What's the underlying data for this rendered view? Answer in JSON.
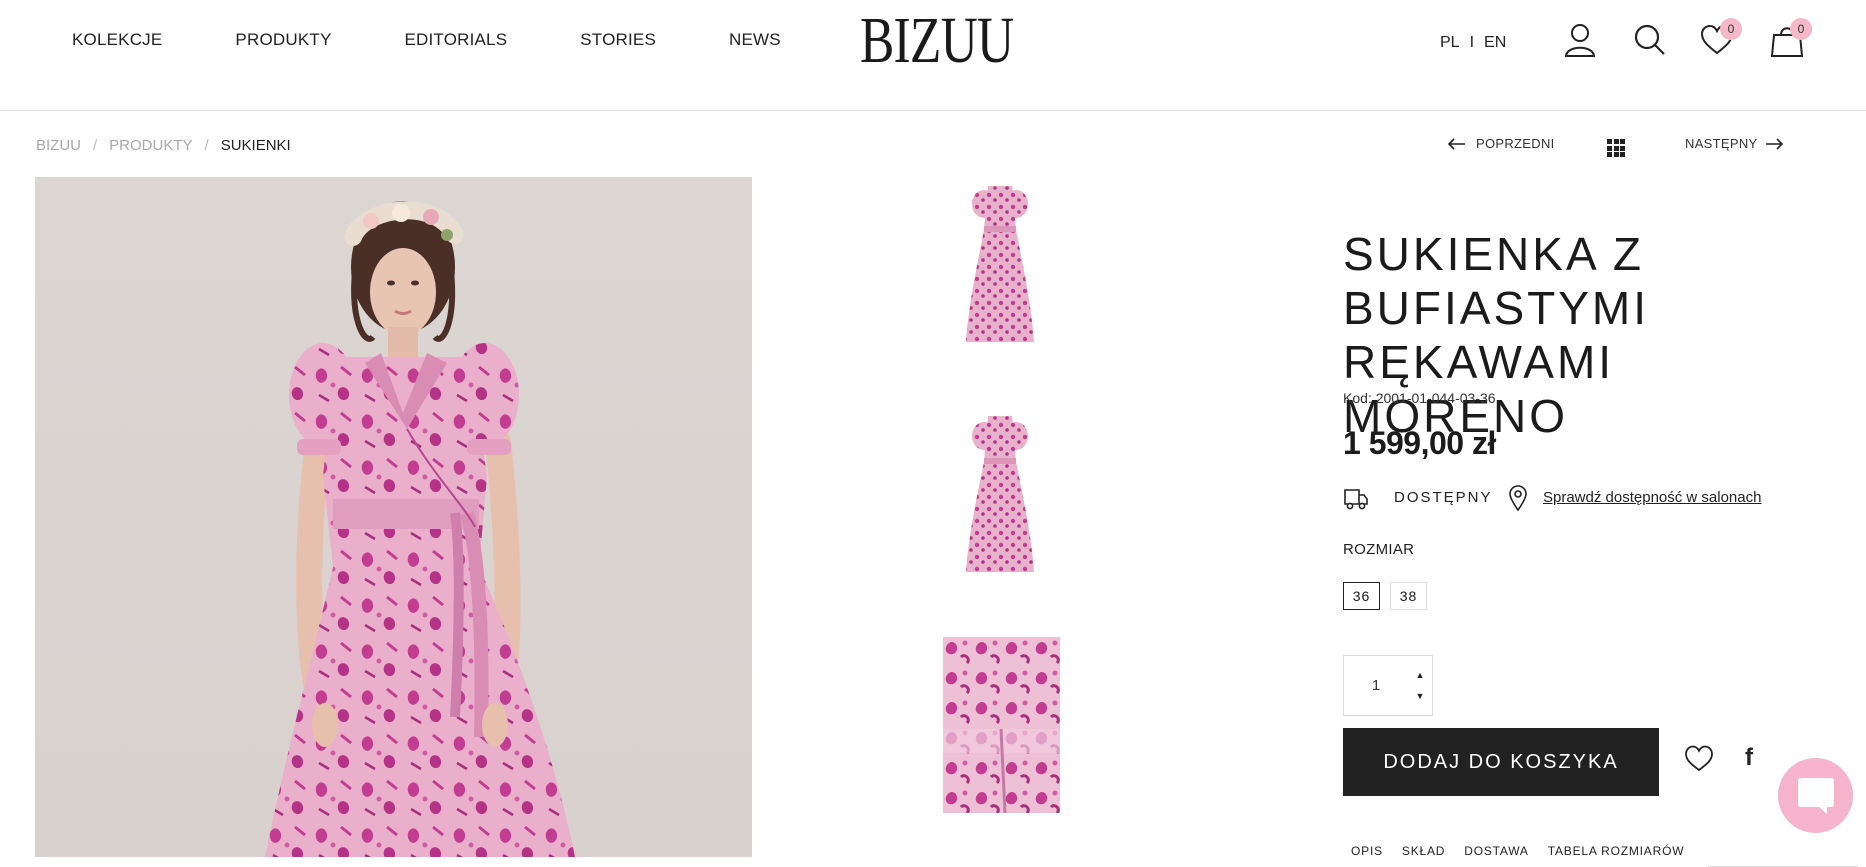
{
  "header": {
    "nav": [
      "KOLEKCJE",
      "PRODUKTY",
      "EDITORIALS",
      "STORIES",
      "NEWS"
    ],
    "logo": "BIZUU",
    "lang": {
      "pl": "PL",
      "sep": "I",
      "en": "EN"
    },
    "wishlist_count": "0",
    "cart_count": "0"
  },
  "breadcrumb": [
    "BIZUU",
    "PRODUKTY",
    "SUKIENKI"
  ],
  "pager": {
    "prev": "POPRZEDNI",
    "next": "NASTĘPNY"
  },
  "product": {
    "title": "SUKIENKA Z BUFIASTYMI RĘKAWAMI MORENO",
    "sku": "Kod: 2001-01-044-03-36",
    "price": "1 599,00 zł",
    "availability": "DOSTĘPNY",
    "salon_link": "Sprawdź dostępność w salonach",
    "size_label": "ROZMIAR",
    "sizes": [
      "36",
      "38"
    ],
    "selected_size": "36",
    "quantity": "1",
    "add_to_cart": "DODAJ DO KOSZYKA",
    "share_fb": "f"
  },
  "tabs": [
    "OPIS",
    "SKŁAD",
    "DOSTAWA",
    "TABELA ROZMIARÓW"
  ],
  "colors": {
    "accent_pink": "#f5b4cb",
    "button_dark": "#222222",
    "dress_pink": "#e8a6c4",
    "dress_print": "#c13e93"
  }
}
